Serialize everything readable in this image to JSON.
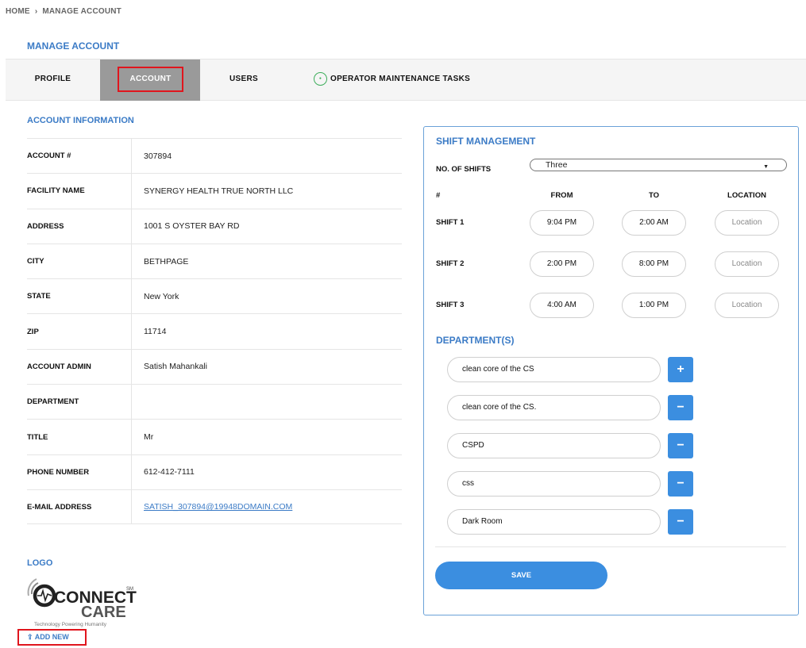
{
  "breadcrumb": {
    "home": "HOME",
    "sep": "›",
    "current": "MANAGE ACCOUNT"
  },
  "page_title": "MANAGE ACCOUNT",
  "tabs": {
    "profile": "PROFILE",
    "account": "ACCOUNT",
    "users": "USERS",
    "operator": "OPERATOR MAINTENANCE TASKS",
    "active": "account"
  },
  "account_info": {
    "title": "ACCOUNT INFORMATION",
    "rows": [
      {
        "label": "ACCOUNT #",
        "value": "307894"
      },
      {
        "label": "FACILITY NAME",
        "value": "SYNERGY HEALTH TRUE NORTH LLC"
      },
      {
        "label": "ADDRESS",
        "value": "1001 S OYSTER BAY RD"
      },
      {
        "label": "CITY",
        "value": "BETHPAGE"
      },
      {
        "label": "STATE",
        "value": "New York"
      },
      {
        "label": "ZIP",
        "value": "11714"
      },
      {
        "label": "ACCOUNT ADMIN",
        "value": "Satish Mahankali"
      },
      {
        "label": "DEPARTMENT",
        "value": ""
      },
      {
        "label": "TITLE",
        "value": "Mr"
      },
      {
        "label": "PHONE NUMBER",
        "value": "612-412-7111"
      },
      {
        "label": "E-MAIL ADDRESS",
        "value": "SATISH_307894@19948DOMAIN.COM"
      }
    ]
  },
  "logo": {
    "title": "LOGO",
    "text_connect": "CONNECT",
    "text_care": "CARE",
    "sm": "SM",
    "tagline": "Technology Powering Humanity",
    "add_new": "ADD NEW"
  },
  "shift": {
    "title": "SHIFT MANAGEMENT",
    "no_of_shifts_label": "NO. OF SHIFTS",
    "no_of_shifts_value": "Three",
    "col_num": "#",
    "col_from": "FROM",
    "col_to": "TO",
    "col_location": "LOCATION",
    "rows": [
      {
        "label": "SHIFT 1",
        "from": "9:04 PM",
        "to": "2:00 AM",
        "location": "Location"
      },
      {
        "label": "SHIFT 2",
        "from": "2:00 PM",
        "to": "8:00 PM",
        "location": "Location"
      },
      {
        "label": "SHIFT 3",
        "from": "4:00 AM",
        "to": "1:00 PM",
        "location": "Location"
      }
    ]
  },
  "departments": {
    "title": "DEPARTMENT(S)",
    "items": [
      {
        "value": "clean core of the CS",
        "action": "+"
      },
      {
        "value": "clean core of the CS.",
        "action": "−"
      },
      {
        "value": "CSPD",
        "action": "−"
      },
      {
        "value": "css",
        "action": "−"
      },
      {
        "value": "Dark Room",
        "action": "−"
      }
    ]
  },
  "save_label": "SAVE",
  "colors": {
    "accent": "#3b8ee0",
    "heading": "#3b7bc6",
    "highlight": "#e0151d",
    "active_tab": "#9a9a9a"
  }
}
